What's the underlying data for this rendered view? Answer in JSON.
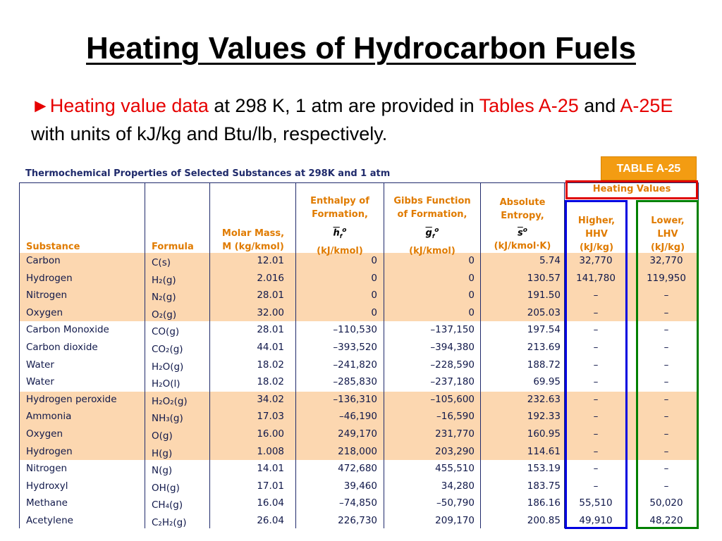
{
  "slide": {
    "title": "Heating Values of Hydrocarbon Fuels",
    "bullet": "►",
    "intro_red1": "Heating value data",
    "intro_black1": " at 298 K, 1 atm are provided in ",
    "intro_red2": "Tables A-25",
    "intro_black2": " and ",
    "intro_red3": "A-25E",
    "intro_black3": " with units of kJ/kg and Btu/lb, respectively."
  },
  "table": {
    "tag": "TABLE A-25",
    "caption": "Thermochemical Properties of Selected Substances at 298K and 1 atm",
    "headers": {
      "substance": "Substance",
      "formula": "Formula",
      "molar_mass_1": "Molar Mass,",
      "molar_mass_2": "M (kg/kmol)",
      "enthalpy_1": "Enthalpy of",
      "enthalpy_2": "Formation,",
      "enthalpy_sym": "h",
      "enthalpy_unit": "(kJ/kmol)",
      "gibbs_1": "Gibbs Function",
      "gibbs_2": "of Formation,",
      "gibbs_sym": "g",
      "gibbs_unit": "(kJ/kmol)",
      "entropy_1": "Absolute",
      "entropy_2": "Entropy,",
      "entropy_sym": "s",
      "entropy_unit": "(kJ/kmol·K)",
      "heating_values": "Heating Values",
      "hhv_1": "Higher,",
      "hhv_2": "HHV",
      "hhv_3": "(kJ/kg)",
      "lhv_1": "Lower,",
      "lhv_2": "LHV",
      "lhv_3": "(kJ/kg)"
    },
    "rows": [
      {
        "substance": "Carbon",
        "formula": "C(s)",
        "mm": "12.01",
        "h": "0",
        "g": "0",
        "s": "5.74",
        "hhv": "32,770",
        "lhv": "32,770"
      },
      {
        "substance": "Hydrogen",
        "formula": "H₂(g)",
        "mm": "2.016",
        "h": "0",
        "g": "0",
        "s": "130.57",
        "hhv": "141,780",
        "lhv": "119,950"
      },
      {
        "substance": "Nitrogen",
        "formula": "N₂(g)",
        "mm": "28.01",
        "h": "0",
        "g": "0",
        "s": "191.50",
        "hhv": "–",
        "lhv": "–"
      },
      {
        "substance": "Oxygen",
        "formula": "O₂(g)",
        "mm": "32.00",
        "h": "0",
        "g": "0",
        "s": "205.03",
        "hhv": "–",
        "lhv": "–"
      },
      {
        "substance": "Carbon Monoxide",
        "formula": "CO(g)",
        "mm": "28.01",
        "h": "–110,530",
        "g": "–137,150",
        "s": "197.54",
        "hhv": "–",
        "lhv": "–"
      },
      {
        "substance": "Carbon dioxide",
        "formula": "CO₂(g)",
        "mm": "44.01",
        "h": "–393,520",
        "g": "–394,380",
        "s": "213.69",
        "hhv": "–",
        "lhv": "–"
      },
      {
        "substance": "Water",
        "formula": "H₂O(g)",
        "mm": "18.02",
        "h": "–241,820",
        "g": "–228,590",
        "s": "188.72",
        "hhv": "–",
        "lhv": "–"
      },
      {
        "substance": "Water",
        "formula": "H₂O(l)",
        "mm": "18.02",
        "h": "–285,830",
        "g": "–237,180",
        "s": "69.95",
        "hhv": "–",
        "lhv": "–"
      },
      {
        "substance": "Hydrogen peroxide",
        "formula": "H₂O₂(g)",
        "mm": "34.02",
        "h": "–136,310",
        "g": "–105,600",
        "s": "232.63",
        "hhv": "–",
        "lhv": "–"
      },
      {
        "substance": "Ammonia",
        "formula": "NH₃(g)",
        "mm": "17.03",
        "h": "–46,190",
        "g": "–16,590",
        "s": "192.33",
        "hhv": "–",
        "lhv": "–"
      },
      {
        "substance": "Oxygen",
        "formula": "O(g)",
        "mm": "16.00",
        "h": "249,170",
        "g": "231,770",
        "s": "160.95",
        "hhv": "–",
        "lhv": "–"
      },
      {
        "substance": "Hydrogen",
        "formula": "H(g)",
        "mm": "1.008",
        "h": "218,000",
        "g": "203,290",
        "s": "114.61",
        "hhv": "–",
        "lhv": "–"
      },
      {
        "substance": "Nitrogen",
        "formula": "N(g)",
        "mm": "14.01",
        "h": "472,680",
        "g": "455,510",
        "s": "153.19",
        "hhv": "–",
        "lhv": "–"
      },
      {
        "substance": "Hydroxyl",
        "formula": "OH(g)",
        "mm": "17.01",
        "h": "39,460",
        "g": "34,280",
        "s": "183.75",
        "hhv": "–",
        "lhv": "–"
      },
      {
        "substance": "Methane",
        "formula": "CH₄(g)",
        "mm": "16.04",
        "h": "–74,850",
        "g": "–50,790",
        "s": "186.16",
        "hhv": "55,510",
        "lhv": "50,020"
      },
      {
        "substance": "Acetylene",
        "formula": "C₂H₂(g)",
        "mm": "26.04",
        "h": "226,730",
        "g": "209,170",
        "s": "200.85",
        "hhv": "49,910",
        "lhv": "48,220"
      }
    ],
    "colors": {
      "band": "#fcd7b0",
      "header_text": "#e07b00",
      "body_text": "#10184a",
      "hhv_box": "#0000e0",
      "lhv_box": "#008000",
      "heating_box": "#e00000",
      "tag_bg": "#f39c12"
    }
  }
}
